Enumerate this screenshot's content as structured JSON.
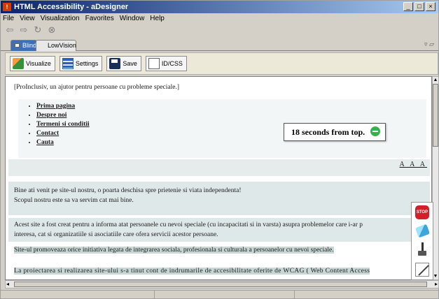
{
  "window": {
    "title": "HTML Accessibility - aDesigner",
    "app_icon": "aDesigner-icon"
  },
  "menu": [
    "File",
    "View",
    "Visualization",
    "Favorites",
    "Window",
    "Help"
  ],
  "tabs": [
    {
      "label": "Blind",
      "active": true
    },
    {
      "label": "LowVision",
      "active": false
    }
  ],
  "toolbar": [
    {
      "label": "Visualize",
      "icon": "visualize-icon"
    },
    {
      "label": "Settings",
      "icon": "settings-icon"
    },
    {
      "label": "Save",
      "icon": "save-icon"
    },
    {
      "label": "ID/CSS",
      "icon": "document-icon"
    }
  ],
  "page": {
    "intro": "[ProInclusiv, un ajutor pentru persoane cu probleme speciale.]",
    "nav_links": [
      "Prima pagina",
      "Despre noi",
      "Termeni si conditii",
      "Contact",
      "Cauta"
    ],
    "font_size_links": "A A A",
    "para1_line1": "Bine ati venit pe site-ul nostru, o poarta deschisa spre prietenie si viata independenta!",
    "para1_line2": "Scopul nostru este sa va servim cat mai bine.",
    "para2_line1": "Acest site a fost creat pentru a informa atat persoanele cu nevoi speciale (cu incapacitati si in varsta) asupra problemelor care i-ar p",
    "para2_line2": "interesa, cat si organizatiile si asociatiile care ofera servicii acestor persoane.",
    "para3": "Site-ul promoveaza orice initiativa legata de integrarea sociala, profesionala si culturala a persoanelor cu nevoi speciale.",
    "para4": "La proiectarea si realizarea site-ului s-a tinut cont de indrumarile de accesibilitate oferite de WCAG ( Web Content Access"
  },
  "timer": {
    "text": "18 seconds from top.",
    "status_color": "#35b34a"
  },
  "tools": [
    {
      "name": "stop",
      "label": "STOP"
    },
    {
      "name": "eraser"
    },
    {
      "name": "brush"
    },
    {
      "name": "pen"
    }
  ],
  "colors": {
    "title_gradient_start": "#0a246a",
    "tab_active": "#3f6fb5",
    "page_band": "#dfe8e8"
  }
}
